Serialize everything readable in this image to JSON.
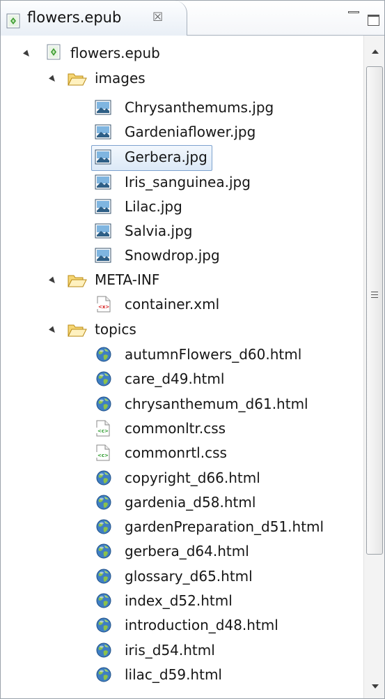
{
  "tab": {
    "title": "flowers.epub",
    "close_glyph": "☒",
    "colors": {
      "epub_icon_green": "#3a9a2e",
      "folder_yellow": "#f2c94c",
      "selection_blue": "#7da2ce"
    }
  },
  "tree": {
    "root": {
      "label": "flowers.epub",
      "icon": "epub-icon",
      "expanded": true
    },
    "images": {
      "label": "images",
      "icon": "folder-open-icon",
      "expanded": true,
      "files": [
        {
          "label": "Chrysanthemums.jpg",
          "icon": "image-file-icon"
        },
        {
          "label": "Gardeniaflower.jpg",
          "icon": "image-file-icon"
        },
        {
          "label": "Gerbera.jpg",
          "icon": "image-file-icon",
          "selected": true
        },
        {
          "label": "Iris_sanguinea.jpg",
          "icon": "image-file-icon"
        },
        {
          "label": "Lilac.jpg",
          "icon": "image-file-icon"
        },
        {
          "label": "Salvia.jpg",
          "icon": "image-file-icon"
        },
        {
          "label": "Snowdrop.jpg",
          "icon": "image-file-icon"
        }
      ]
    },
    "meta_inf": {
      "label": "META-INF",
      "icon": "folder-open-icon",
      "expanded": true,
      "files": [
        {
          "label": "container.xml",
          "icon": "xml-file-icon"
        }
      ]
    },
    "topics": {
      "label": "topics",
      "icon": "folder-open-icon",
      "expanded": true,
      "files": [
        {
          "label": "autumnFlowers_d60.html",
          "icon": "html-globe-icon"
        },
        {
          "label": "care_d49.html",
          "icon": "html-globe-icon"
        },
        {
          "label": "chrysanthemum_d61.html",
          "icon": "html-globe-icon"
        },
        {
          "label": "commonltr.css",
          "icon": "css-file-icon"
        },
        {
          "label": "commonrtl.css",
          "icon": "css-file-icon"
        },
        {
          "label": "copyright_d66.html",
          "icon": "html-globe-icon"
        },
        {
          "label": "gardenia_d58.html",
          "icon": "html-globe-icon"
        },
        {
          "label": "gardenPreparation_d51.html",
          "icon": "html-globe-icon"
        },
        {
          "label": "gerbera_d64.html",
          "icon": "html-globe-icon"
        },
        {
          "label": "glossary_d65.html",
          "icon": "html-globe-icon"
        },
        {
          "label": "index_d52.html",
          "icon": "html-globe-icon"
        },
        {
          "label": "introduction_d48.html",
          "icon": "html-globe-icon"
        },
        {
          "label": "iris_d54.html",
          "icon": "html-globe-icon"
        },
        {
          "label": "lilac_d59.html",
          "icon": "html-globe-icon"
        }
      ]
    }
  }
}
